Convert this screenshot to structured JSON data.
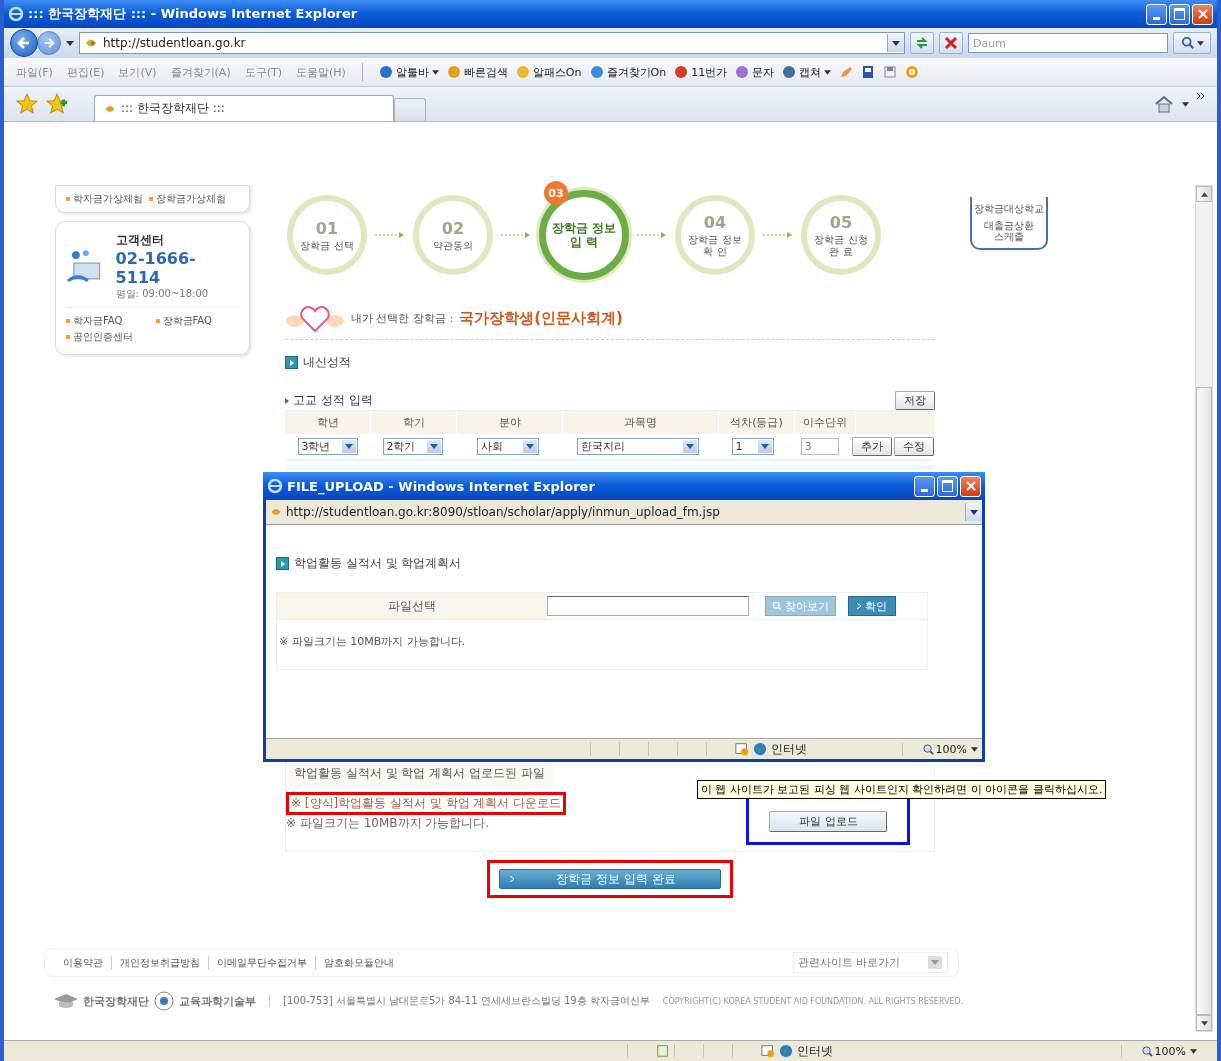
{
  "window": {
    "title": "::: 한국장학재단 ::: - Windows Internet Explorer"
  },
  "address_bar": {
    "url": "http://studentloan.go.kr",
    "search_placeholder": "Daum"
  },
  "menu": [
    "파일(F)",
    "편집(E)",
    "보기(V)",
    "즐겨찾기(A)",
    "도구(T)",
    "도움말(H)"
  ],
  "toolbar": [
    {
      "label": "알툴바",
      "dropdown": true
    },
    {
      "label": "빠른검색",
      "dropdown": false
    },
    {
      "label": "알패스On",
      "dropdown": false
    },
    {
      "label": "즐겨찾기On",
      "dropdown": false
    },
    {
      "label": "11번가",
      "dropdown": false
    },
    {
      "label": "문자",
      "dropdown": false
    },
    {
      "label": "캡쳐",
      "dropdown": true
    }
  ],
  "tabs": [
    {
      "label": "::: 한국장학재단 :::",
      "selected": true
    }
  ],
  "sidebar": {
    "links_top": [
      "학자금가상체험",
      "장학금가상체험"
    ],
    "support": {
      "title": "고객센터",
      "phone": "02-1666-5114",
      "hours": "평일: 09:00~18:00"
    },
    "links": [
      "학자금FAQ",
      "장학금FAQ",
      "공인인증센터"
    ]
  },
  "steps": [
    {
      "number": "01",
      "lines": [
        "장학금 선택"
      ],
      "selected": false
    },
    {
      "number": "02",
      "lines": [
        "약관동의"
      ],
      "selected": false
    },
    {
      "number": "03",
      "lines": [
        "장학금 정보",
        "입 력"
      ],
      "selected": true
    },
    {
      "number": "04",
      "lines": [
        "장학금 정보",
        "확 인"
      ],
      "selected": false
    },
    {
      "number": "05",
      "lines": [
        "장학금 신청",
        "완 료"
      ],
      "selected": false
    }
  ],
  "quick_menu": [
    {
      "lines": [
        "장학금대상학교"
      ]
    },
    {
      "lines": [
        "대출금상환",
        "스케줄"
      ]
    }
  ],
  "selected_scholarship": {
    "label": "내가 선택한 장학금 :",
    "value": "국가장학생(인문사회계)"
  },
  "grades": {
    "section": "내신성적",
    "subtitle": "고교 성적 입력",
    "save": "저장",
    "columns": [
      "학년",
      "학기",
      "분야",
      "과목명",
      "석차(등급)",
      "이수단위"
    ],
    "row": {
      "grade": "3학년",
      "term": "2학기",
      "field": "사회",
      "subject": "한국지리",
      "rank": "1",
      "units": "3"
    },
    "buttons": [
      "추가",
      "수정"
    ]
  },
  "popup": {
    "title": "FILE_UPLOAD - Windows Internet Explorer",
    "url": "http://studentloan.go.kr:8090/stloan/scholar/apply/inmun_upload_fm.jsp",
    "section": "학업활동 실적서 및 학업계획서",
    "file_label": "파일선택",
    "browse": "찾아보기",
    "confirm": "확인",
    "note": "※ 파일크기는 10MB까지 가능합니다.",
    "status": {
      "zone": "인터넷",
      "zoom": "100%"
    }
  },
  "upload_section": {
    "title": "학업활동 실적서 및 학업 계획서 업로드된 파일",
    "link": "※ [양식]학업활동 실적서 및 학업 계획서 다운로드",
    "note": "※ 파일크기는 10MB까지 가능합니다.",
    "upload_button": "파일 업로드",
    "tooltip": "이 웹 사이트가 보고된 피싱 웹 사이트인지 확인하려면 이 아이콘을 클릭하십시오."
  },
  "submit_button": "장학금 정보 입력 완료",
  "footer": {
    "links": [
      "이용약관",
      "개인정보취급방침",
      "이메일무단수집거부",
      "암호화모듈안내"
    ],
    "related_sites": "관련사이트 바로가기",
    "org": "한국장학재단",
    "ministry": "교육과학기술부",
    "address": "[100-753] 서울특별시 남대문로5가 84-11 연세세브란스빌딩 19층  학자금여신부",
    "copyright": "COPYRIGHT(C) KOREA STUDENT AID FOUNDATION. ALL RIGHTS RESERVED."
  },
  "status_bar": {
    "zone": "인터넷",
    "zoom": "100%"
  }
}
